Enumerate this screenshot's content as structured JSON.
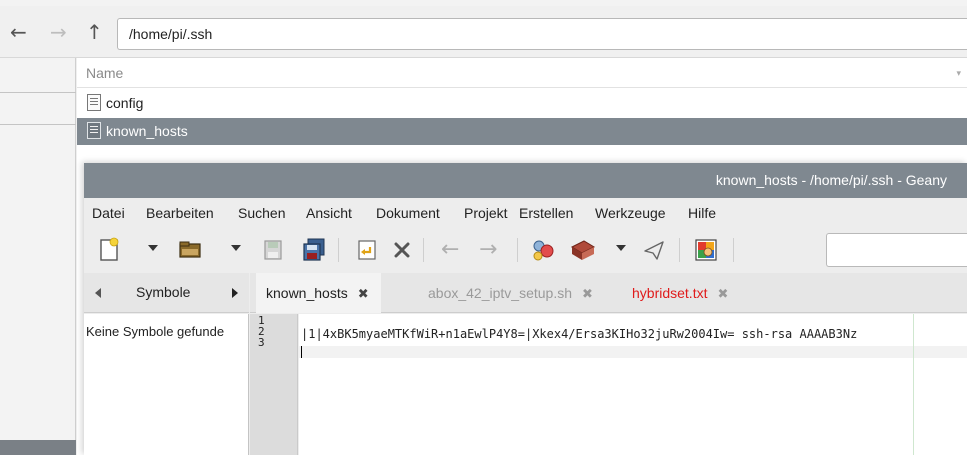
{
  "file_manager": {
    "path": "/home/pi/.ssh",
    "column_name": "Name",
    "files": [
      {
        "name": "config",
        "selected": false
      },
      {
        "name": "known_hosts",
        "selected": true
      }
    ]
  },
  "geany": {
    "title": "known_hosts - /home/pi/.ssh - Geany",
    "menu": [
      "Datei",
      "Bearbeiten",
      "Suchen",
      "Ansicht",
      "Dokument",
      "Projekt",
      "Erstellen",
      "Werkzeuge",
      "Hilfe"
    ],
    "sidebar": {
      "tab_label": "Symbole",
      "message": "Keine Symbole gefunde"
    },
    "tabs": [
      {
        "label": "known_hosts",
        "state": "active"
      },
      {
        "label": "abox_42_iptv_setup.sh",
        "state": "inactive"
      },
      {
        "label": "hybridset.txt",
        "state": "modified"
      }
    ],
    "tab_close_glyph": "✖",
    "line_numbers": [
      "1",
      "2",
      "3"
    ],
    "code_line_2": "|1|4xBK5myaeMTKfWiR+n1aEwlP4Y8=|Xkex4/Ersa3KIHo32juRw2004Iw= ssh-rsa AAAAB3Nz",
    "colors": {
      "titlebar": "#7f8890",
      "selection": "#7f8890",
      "modified_tab": "#e01b1b"
    },
    "toolbar_icons": [
      "new-file-icon",
      "open-file-icon",
      "save-icon",
      "save-all-icon",
      "revert-icon",
      "close-icon",
      "back-icon",
      "forward-icon",
      "compile-icon",
      "build-icon",
      "execute-icon",
      "color-picker-icon"
    ]
  }
}
